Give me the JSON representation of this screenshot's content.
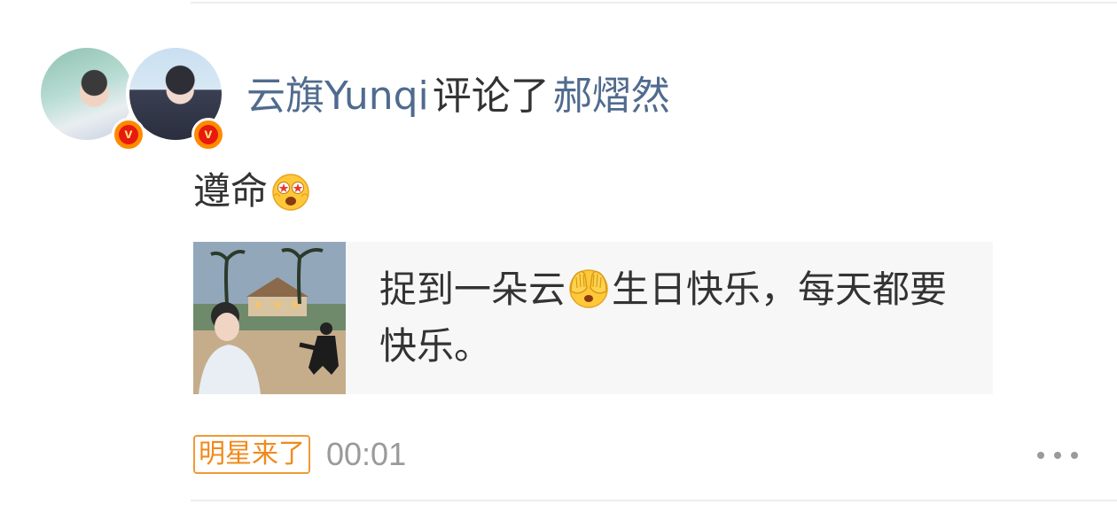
{
  "feed_item": {
    "user_name": "云旗Yunqi",
    "action": "评论了",
    "target_user": "郝熠然",
    "comment_text": "遵命",
    "comment_emoji": "starstruck-face-icon",
    "quoted_post": {
      "text_before_emoji": "捉到一朵云",
      "emoji": "see-no-evil-face-icon",
      "text_after_emoji": "生日快乐，每天都要快乐。"
    },
    "tag": "明星来了",
    "time": "00:01",
    "more_icon": "more-dots-icon"
  },
  "colors": {
    "link": "#506b8e",
    "text": "#333333",
    "muted": "#9a9a9a",
    "tag_orange": "#f08a1c",
    "verified_red": "#e8190e",
    "card_bg": "#f7f7f7"
  }
}
